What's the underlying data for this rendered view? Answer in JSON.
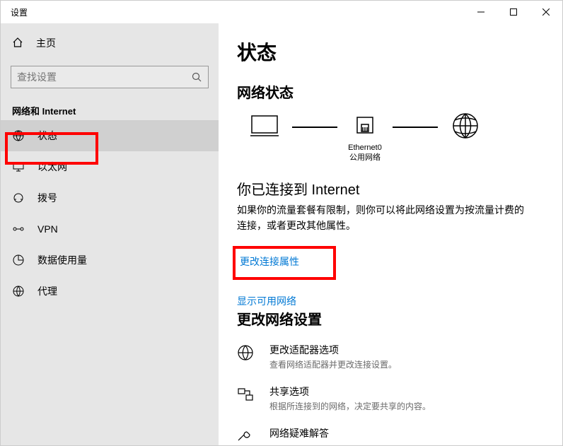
{
  "window": {
    "title": "设置"
  },
  "sidebar": {
    "home_label": "主页",
    "search_placeholder": "查找设置",
    "category": "网络和 Internet",
    "items": [
      {
        "key": "status",
        "label": "状态",
        "selected": true
      },
      {
        "key": "ethernet",
        "label": "以太网",
        "selected": false
      },
      {
        "key": "dialup",
        "label": "拨号",
        "selected": false
      },
      {
        "key": "vpn",
        "label": "VPN",
        "selected": false
      },
      {
        "key": "datausage",
        "label": "数据使用量",
        "selected": false
      },
      {
        "key": "proxy",
        "label": "代理",
        "selected": false
      }
    ]
  },
  "main": {
    "page_title": "状态",
    "network_status_title": "网络状态",
    "diagram": {
      "adapter_name": "Ethernet0",
      "adapter_type": "公用网络"
    },
    "connected_heading": "你已连接到 Internet",
    "connected_desc": "如果你的流量套餐有限制，则你可以将此网络设置为按流量计费的连接，或者更改其他属性。",
    "change_props_link": "更改连接属性",
    "show_networks_link": "显示可用网络",
    "change_settings_title": "更改网络设置",
    "options": [
      {
        "title": "更改适配器选项",
        "desc": "查看网络适配器并更改连接设置。",
        "icon": "globe"
      },
      {
        "title": "共享选项",
        "desc": "根据所连接到的网络，决定要共享的内容。",
        "icon": "share"
      },
      {
        "title": "网络疑难解答",
        "desc": "",
        "icon": "troubleshoot"
      }
    ]
  }
}
